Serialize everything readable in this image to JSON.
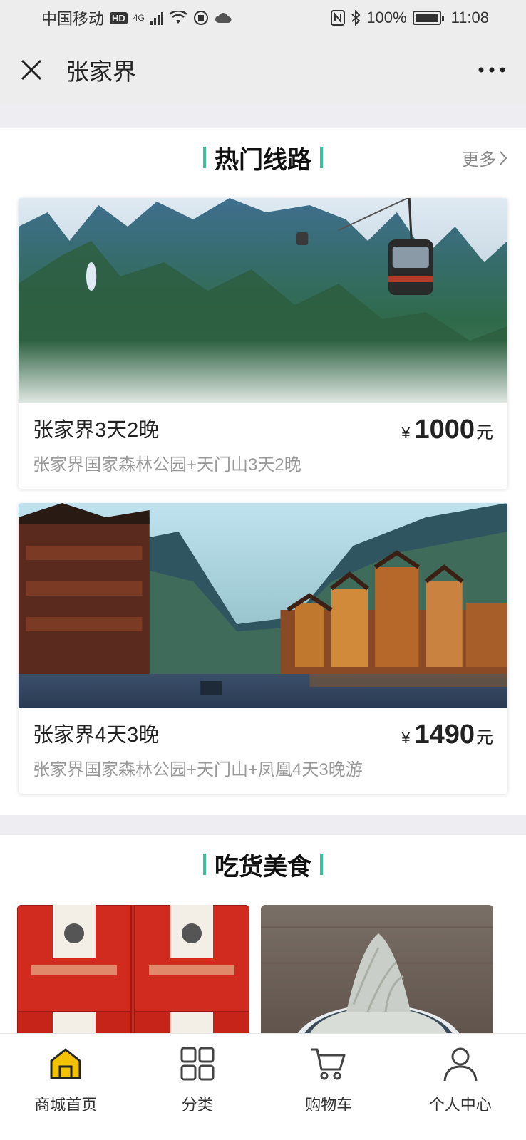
{
  "status_bar": {
    "carrier": "中国移动",
    "hd": "HD",
    "network": "4G",
    "battery_pct": "100%",
    "time": "11:08"
  },
  "header": {
    "title": "张家界",
    "close_icon": "close-icon",
    "more_icon": "more-dots-icon"
  },
  "hot_routes": {
    "title": "热门线路",
    "more_label": "更多",
    "items": [
      {
        "name": "张家界3天2晚",
        "desc": "张家界国家森林公园+天门山3天2晚",
        "currency": "¥",
        "price": "1000",
        "unit": "元"
      },
      {
        "name": "张家界4天3晚",
        "desc": "张家界国家森林公园+天门山+凤凰4天3晚游",
        "currency": "¥",
        "price": "1490",
        "unit": "元"
      }
    ]
  },
  "food": {
    "title": "吃货美食"
  },
  "tab_bar": {
    "tabs": [
      {
        "label": "商城首页",
        "icon": "home-icon",
        "active": true
      },
      {
        "label": "分类",
        "icon": "grid-icon"
      },
      {
        "label": "购物车",
        "icon": "cart-icon"
      },
      {
        "label": "个人中心",
        "icon": "user-icon"
      }
    ]
  },
  "colors": {
    "accent": "#3cbf9e",
    "home_icon_fill": "#f2c200"
  }
}
